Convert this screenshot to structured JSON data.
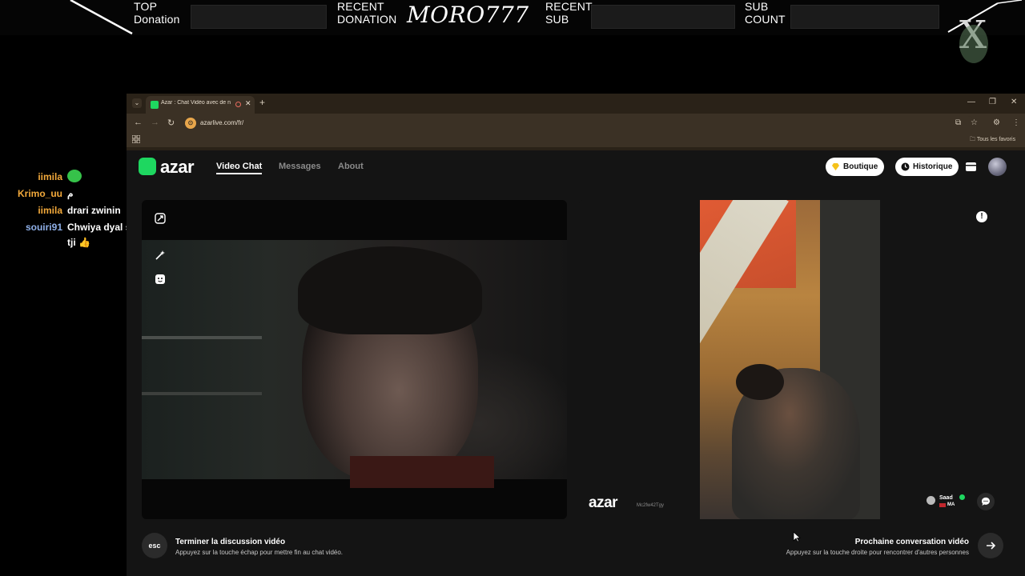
{
  "overlay": {
    "top_donation_label": "TOP Donation",
    "top_donation_line1": "TOP",
    "top_donation_line2": "Donation",
    "recent_donation_line1": "RECENT",
    "recent_donation_line2": "DONATION",
    "recent_donation_name": "MORO777",
    "recent_sub_line1": "RECENT",
    "recent_sub_line2": "SUB",
    "sub_count_line1": "SUB",
    "sub_count_line2": "COUNT"
  },
  "stream_chat": [
    {
      "user": "iimila",
      "user_color": "#f2a93b",
      "message": ""
    },
    {
      "user": "Krimo_uu",
      "user_color": "#f2a93b",
      "message": "م"
    },
    {
      "user": "iimila",
      "user_color": "#f2a93b",
      "message": "drari zwinin"
    },
    {
      "user": "souiri91",
      "user_color": "#8fb0e8",
      "message": "Chwiya dyal s"
    },
    {
      "user": "",
      "user_color": "#ffffff",
      "message": "tji 👍"
    }
  ],
  "browser": {
    "tab_title": "Azar : Chat Vidéo avec de n",
    "url": "azarlive.com/fr/",
    "bookmarks_folder": "Tous les favoris"
  },
  "azar": {
    "logo": "azar",
    "nav": [
      "Video Chat",
      "Messages",
      "About"
    ],
    "boutique_label": "Boutique",
    "historique_label": "Historique",
    "watermark_id": "Mc2fw42Tgy",
    "peer_name": "Saad",
    "peer_country": "MA",
    "end_key": "esc",
    "end_title": "Terminer la discussion vidéo",
    "end_subtitle": "Appuyez sur la touche échap pour mettre fin au chat vidéo.",
    "next_title": "Prochaine conversation vidéo",
    "next_subtitle": "Appuyez sur la touche droite pour rencontrer d'autres personnes"
  },
  "colors": {
    "accent_green": "#1ed760",
    "browser_frame": "#2a2218",
    "page_bg": "#141414"
  }
}
